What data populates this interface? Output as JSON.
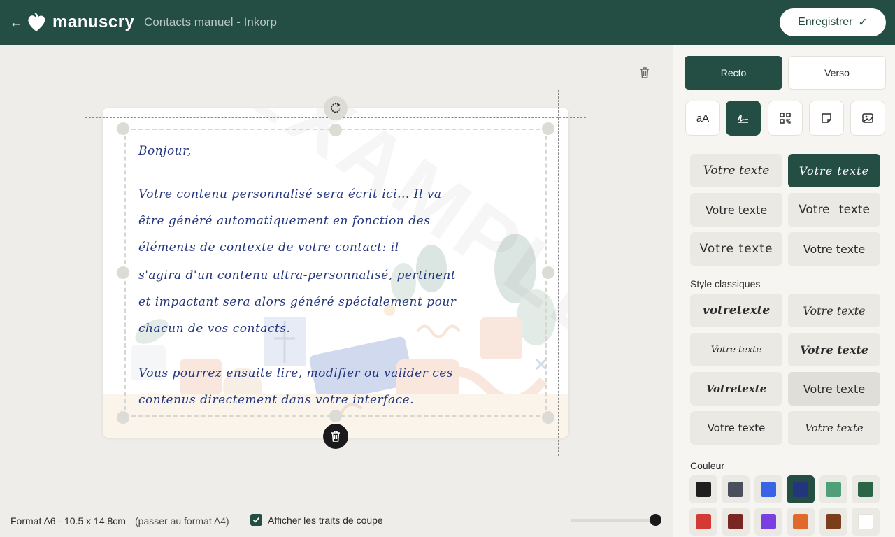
{
  "header": {
    "back_icon": "arrow-left-icon",
    "brand": "manuscry",
    "document_title": "Contacts manuel - Inkorp",
    "save_label": "Enregistrer",
    "save_icon": "check-icon",
    "colors": {
      "bar": "#244d43",
      "button_bg": "#ffffff",
      "button_text": "#244d43"
    }
  },
  "card": {
    "greeting": "Bonjour,",
    "lines": [
      "Votre contenu personnalisé sera écrit ici... Il va",
      "être généré automatiquement en fonction des",
      "éléments de contexte de votre contact: il",
      "s'agira d'un contenu ultra-personnalisé, pertinent",
      "et impactant sera alors généré spécialement pour",
      "chacun de vos contacts.",
      "Vous pourrez ensuite lire, modifier ou valider ces",
      "contenus directement dans votre interface."
    ],
    "watermark": "EXAMPLE",
    "ink_color": "#23367d"
  },
  "canvas": {
    "rotate_icon": "rotate-icon",
    "delete_icon": "trash-icon"
  },
  "footer": {
    "format": "Format A6 - 10.5 x 14.8cm",
    "switch_format": "(passer au format A4)",
    "show_cut_lines_label": "Afficher les traits de coupe",
    "show_cut_lines_checked": true,
    "zoom_level": 1.0
  },
  "panel": {
    "sides": [
      {
        "label": "Recto",
        "active": true
      },
      {
        "label": "Verso",
        "active": false
      }
    ],
    "tools": [
      {
        "name": "text-size-tool",
        "icon": "text-size-icon",
        "label": "aA",
        "active": false
      },
      {
        "name": "handwriting-tool",
        "icon": "handwriting-icon",
        "active": true
      },
      {
        "name": "qr-code-tool",
        "icon": "qr-code-icon",
        "active": false
      },
      {
        "name": "sticker-tool",
        "icon": "sticky-note-icon",
        "active": false
      },
      {
        "name": "image-tool",
        "icon": "image-icon",
        "active": false
      }
    ],
    "handwriting_styles": [
      {
        "label": "Votre texte",
        "active": false
      },
      {
        "label": "Votre texte",
        "active": true
      },
      {
        "label": "Votre texte",
        "active": false
      },
      {
        "label": "Votre texte",
        "active": false
      },
      {
        "label": "Votre texte",
        "active": false
      },
      {
        "label": "Votre texte",
        "active": false
      }
    ],
    "classic_title": "Style classiques",
    "classic_styles": [
      {
        "label": "votretexte",
        "active": false
      },
      {
        "label": "Votre texte",
        "active": false
      },
      {
        "label": "Votre texte",
        "active": false
      },
      {
        "label": "Votre texte",
        "active": false
      },
      {
        "label": "Votretexte",
        "active": false
      },
      {
        "label": "Votre texte",
        "active": false
      },
      {
        "label": "Votre texte",
        "active": false
      },
      {
        "label": "Votre texte",
        "active": false
      }
    ],
    "color_title": "Couleur",
    "colors": [
      {
        "value": "#1f1f1f",
        "selected": false
      },
      {
        "value": "#4a4f5c",
        "selected": false
      },
      {
        "value": "#3a63e6",
        "selected": false
      },
      {
        "value": "#23367d",
        "selected": true
      },
      {
        "value": "#4f9f7a",
        "selected": false
      },
      {
        "value": "#2c6447",
        "selected": false
      },
      {
        "value": "#d23a33",
        "selected": false
      },
      {
        "value": "#7a2622",
        "selected": false
      },
      {
        "value": "#7a3fe0",
        "selected": false
      },
      {
        "value": "#e06a2c",
        "selected": false
      },
      {
        "value": "#7a3e1a",
        "selected": false
      },
      {
        "value": "#ffffff",
        "selected": false
      }
    ]
  }
}
